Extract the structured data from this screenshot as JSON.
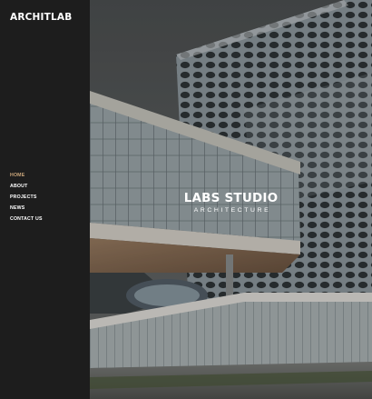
{
  "brand": {
    "logo": "ARCHITLAB"
  },
  "nav": {
    "items": [
      {
        "label": "HOME",
        "active": true
      },
      {
        "label": "ABOUT",
        "active": false
      },
      {
        "label": "PROJECTS",
        "active": false
      },
      {
        "label": "NEWS",
        "active": false
      },
      {
        "label": "CONTACT US",
        "active": false
      }
    ]
  },
  "hero": {
    "title": "LABS STUDIO",
    "subtitle": "ARCHITECTURE"
  },
  "colors": {
    "sidebar_bg": "#1d1d1d",
    "active_nav": "#c9a57a",
    "text": "#ffffff"
  }
}
